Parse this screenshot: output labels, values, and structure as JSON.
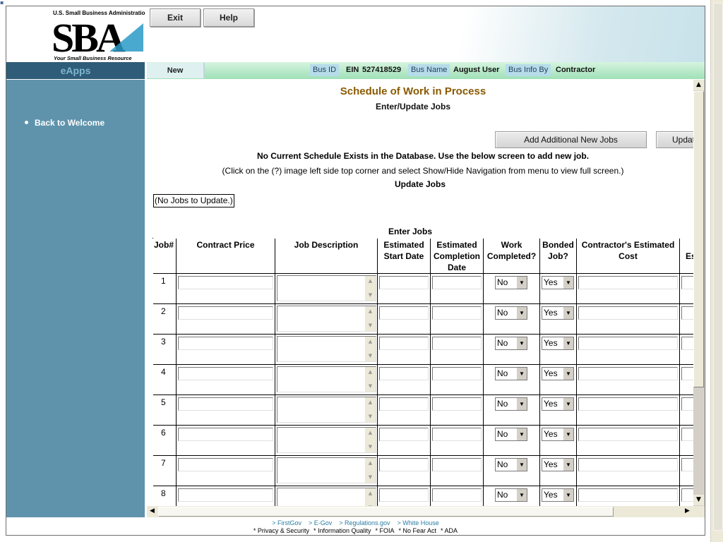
{
  "header": {
    "logo_agency": "U.S. Small Business Administration",
    "logo_mark": "SBA",
    "logo_tagline": "Your Small Business Resource",
    "exit_label": "Exit",
    "help_label": "Help"
  },
  "nav": {
    "app_name": "eApps",
    "new_tab": "New",
    "bus_id_label": "Bus ID",
    "ein_label": "EIN",
    "ein_value": "527418529",
    "bus_name_label": "Bus Name",
    "bus_name_value": "August User",
    "bus_info_by_label": "Bus Info By",
    "bus_info_by_value": "Contractor"
  },
  "sidebar": {
    "back_link": "Back to Welcome"
  },
  "main": {
    "title": "Schedule of Work in Process",
    "subtitle": "Enter/Update Jobs",
    "add_jobs_button": "Add Additional New Jobs",
    "update_button": "Update",
    "no_schedule_msg": "No Current Schedule Exists in the Database. Use the below screen to add new job.",
    "help_msg": "(Click on the (?) image left side top corner and select Show/Hide Navigation from menu to view full screen.)",
    "update_jobs_heading": "Update Jobs",
    "no_jobs_msg": "(No Jobs to Update.)",
    "enter_jobs_heading": "Enter Jobs",
    "columns": [
      "Job#",
      "Contract Price",
      "Job Description",
      "Estimated Start Date",
      "Estimated Completion Date",
      "Work Completed?",
      "Bonded Job?",
      "Contractor's Estimated Cost",
      "Es"
    ],
    "rows": [
      {
        "job": "1",
        "work_completed": "No",
        "bonded": "Yes"
      },
      {
        "job": "2",
        "work_completed": "No",
        "bonded": "Yes"
      },
      {
        "job": "3",
        "work_completed": "No",
        "bonded": "Yes"
      },
      {
        "job": "4",
        "work_completed": "No",
        "bonded": "Yes"
      },
      {
        "job": "5",
        "work_completed": "No",
        "bonded": "Yes"
      },
      {
        "job": "6",
        "work_completed": "No",
        "bonded": "Yes"
      },
      {
        "job": "7",
        "work_completed": "No",
        "bonded": "Yes"
      },
      {
        "job": "8",
        "work_completed": "No",
        "bonded": "Yes"
      }
    ]
  },
  "footer": {
    "links": [
      "> FirstGov",
      "> E-Gov",
      "> Regulations.gov",
      "> White House"
    ],
    "legal": [
      "* Privacy & Security",
      "* Information Quality",
      "* FOIA",
      "* No Fear Act",
      "* ADA"
    ]
  },
  "colors": {
    "sidebar_bg": "#5f93ac",
    "eapps_bar_bg": "#2f5c78",
    "title_color": "#8a5a00",
    "info_bar_green": "#9fe0b7"
  },
  "icons": [
    "menu-corner-icon",
    "scroll-up-icon",
    "scroll-down-icon",
    "scroll-left-icon",
    "scroll-right-icon",
    "dropdown-arrow-icon"
  ]
}
